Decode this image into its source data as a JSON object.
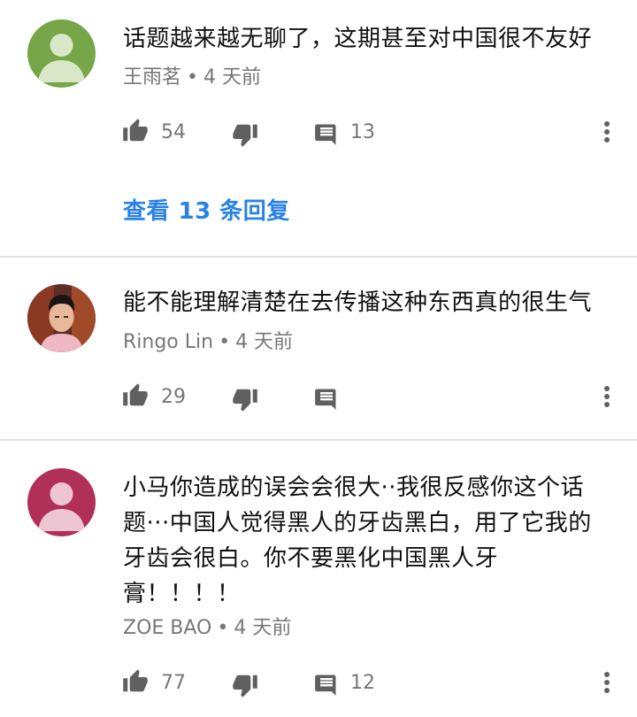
{
  "comments": [
    {
      "text": "话题越来越无聊了，这期甚至对中国很不友好",
      "author": "王雨茗",
      "time": "4 天前",
      "likes": "54",
      "reply_count": "13",
      "view_replies": "查看 13 条回复",
      "avatar_color": "#77a649"
    },
    {
      "text": "能不能理解清楚在去传播这种东西真的很生气",
      "author": "Ringo Lin",
      "time": "4 天前",
      "likes": "29",
      "reply_count": ""
    },
    {
      "text_lines": [
        "小马你造成的误会会很大··我很反感你这个话",
        "题···中国人觉得黑人的牙齿黑白，用了它我的",
        "牙齿会很白。你不要黑化中国黑人牙",
        "膏！！！！"
      ],
      "author": "ZOE BAO",
      "time": "4 天前",
      "likes": "77",
      "reply_count": "12",
      "avatar_color": "#b0305a"
    }
  ],
  "separator": "•",
  "icons": {
    "like": "thumbs-up-icon",
    "dislike": "thumbs-down-icon",
    "reply": "comment-icon",
    "more": "more-vert-icon"
  },
  "colors": {
    "link": "#2a82e4",
    "meta": "#777777",
    "icon": "#606060"
  }
}
